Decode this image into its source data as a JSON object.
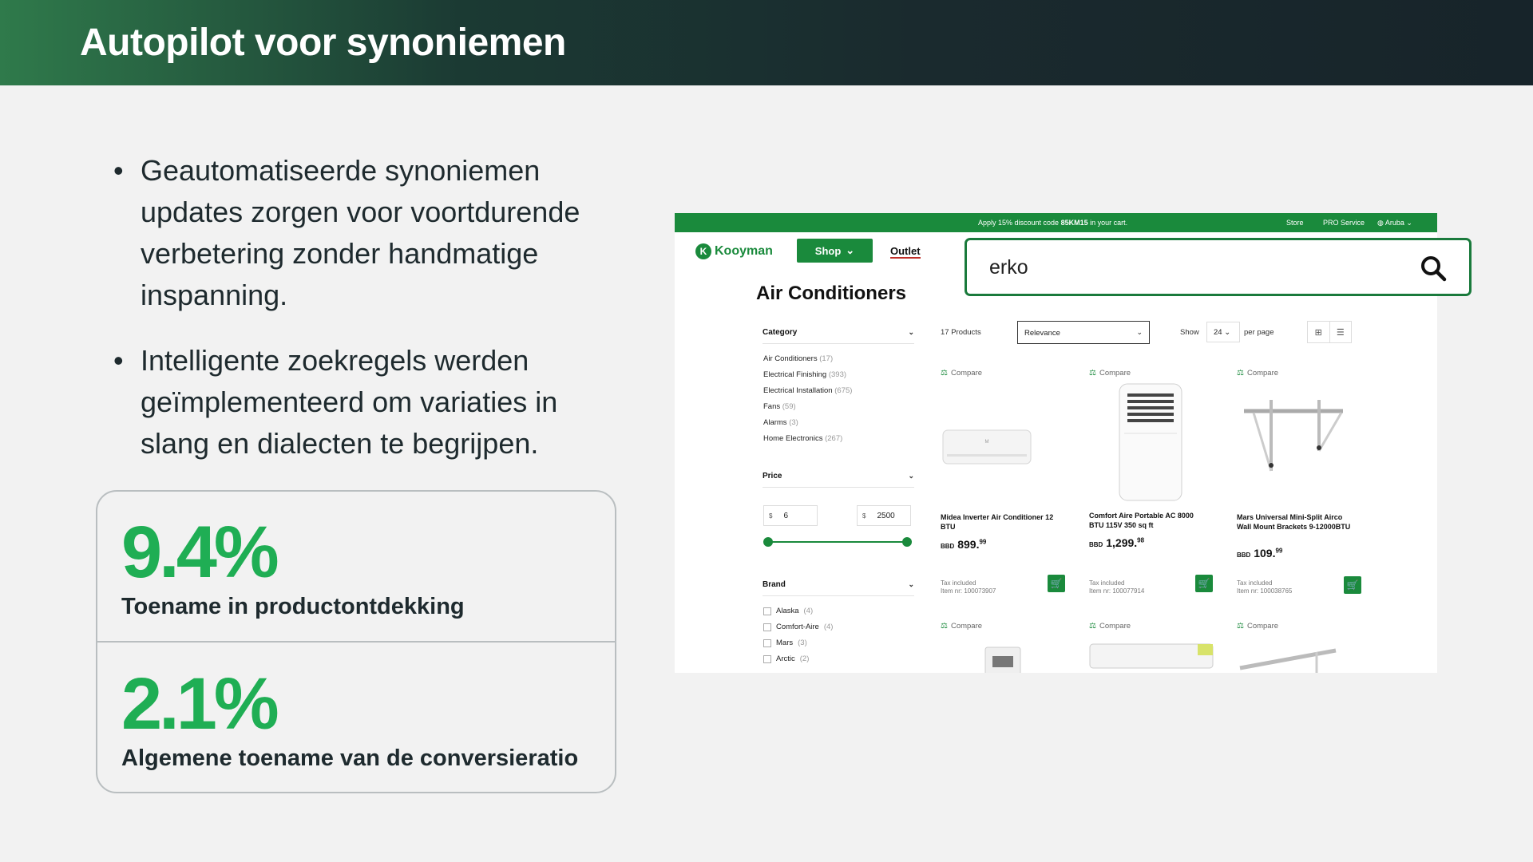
{
  "slide": {
    "title": "Autopilot voor synoniemen",
    "bullets": [
      "Geautomatiseerde synoniemen updates zorgen voor voortdurende verbetering zonder handmatige inspanning.",
      "Intelligente zoekregels werden geïmplementeerd om variaties in slang en dialecten te begrijpen."
    ],
    "stats": [
      {
        "value": "9.4%",
        "label": "Toename in productontdekking"
      },
      {
        "value": "2.1%",
        "label": "Algemene toename van de conversieratio"
      }
    ]
  },
  "shop": {
    "topbar": {
      "promo_pre": "Apply 15% discount code ",
      "promo_code": "85KM15",
      "promo_post": " in your cart.",
      "store": "Store",
      "pro": "PRO Service",
      "region": "Aruba"
    },
    "logo": "Kooyman",
    "shop_label": "Shop",
    "outlet_label": "Outlet",
    "page_title": "Air Conditioners",
    "search_query": "erko",
    "filters": {
      "category_title": "Category",
      "categories": [
        {
          "name": "Air Conditioners",
          "count": "(17)"
        },
        {
          "name": "Electrical Finishing",
          "count": "(393)"
        },
        {
          "name": "Electrical Installation",
          "count": "(675)"
        },
        {
          "name": "Fans",
          "count": "(59)"
        },
        {
          "name": "Alarms",
          "count": "(3)"
        },
        {
          "name": "Home Electronics",
          "count": "(267)"
        }
      ],
      "price_title": "Price",
      "currency": "$",
      "price_min": "6",
      "price_max": "2500",
      "brand_title": "Brand",
      "brands": [
        {
          "name": "Alaska",
          "count": "(4)"
        },
        {
          "name": "Comfort-Aire",
          "count": "(4)"
        },
        {
          "name": "Mars",
          "count": "(3)"
        },
        {
          "name": "Arctic",
          "count": "(2)"
        }
      ]
    },
    "toolbar": {
      "count": "17 Products",
      "sort": "Relevance",
      "show": "Show",
      "per_value": "24",
      "per_page": "per page"
    },
    "compare_label": "Compare",
    "tax_label": "Tax included",
    "products": [
      {
        "name": "Midea Inverter Air Conditioner 12 BTU",
        "currency": "BBD",
        "price": "899.",
        "cents": "99",
        "item": "Item nr: 100073907"
      },
      {
        "name": "Comfort Aire Portable AC 8000 BTU 115V 350 sq ft",
        "currency": "BBD",
        "price": "1,299.",
        "cents": "98",
        "item": "Item nr: 100077914"
      },
      {
        "name": "Mars Universal Mini-Split Airco Wall Mount Brackets 9-12000BTU",
        "currency": "BBD",
        "price": "109.",
        "cents": "99",
        "item": "Item nr: 100038765"
      }
    ],
    "colors": {
      "brand_green": "#1a8a3c",
      "stat_green": "#1fae54"
    }
  }
}
